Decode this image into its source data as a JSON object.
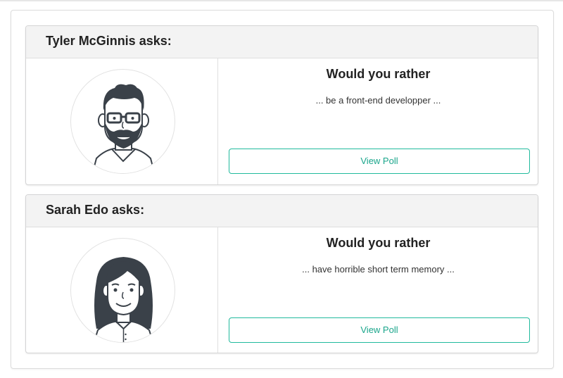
{
  "polls": [
    {
      "asker": "Tyler McGinnis asks:",
      "avatar_icon": "bearded-man-avatar-icon",
      "question_title": "Would you rather",
      "snippet": "... be a front-end developper ...",
      "button_label": "View Poll"
    },
    {
      "asker": "Sarah Edo asks:",
      "avatar_icon": "woman-avatar-icon",
      "question_title": "Would you rather",
      "snippet": "... have horrible short term memory ...",
      "button_label": "View Poll"
    }
  ],
  "colors": {
    "accent": "#21ba9d",
    "header_bg": "#f3f3f3",
    "avatar_dark": "#3a4149"
  }
}
